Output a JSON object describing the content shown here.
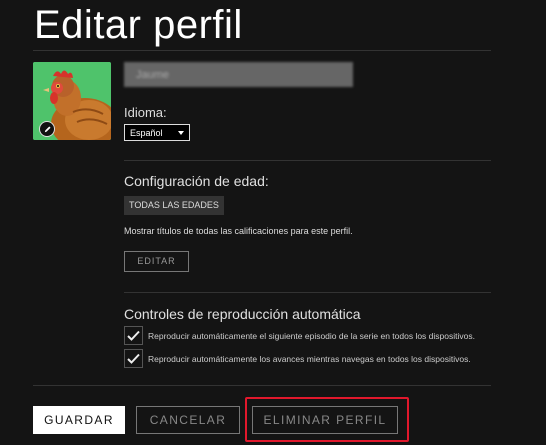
{
  "page": {
    "title": "Editar perfil"
  },
  "profile": {
    "name_value": "Jaume",
    "avatar_icon": "chicken-avatar-image",
    "edit_avatar_icon": "pencil-icon"
  },
  "language": {
    "label": "Idioma:",
    "selected": "Español"
  },
  "age": {
    "section_title": "Configuración de edad:",
    "badge": "TODAS LAS EDADES",
    "description": "Mostrar títulos de todas las calificaciones para este perfil.",
    "edit_button": "EDITAR"
  },
  "autoplay": {
    "section_title": "Controles de reproducción automática",
    "options": [
      {
        "label": "Reproducir automáticamente el siguiente episodio de la serie en todos los dispositivos.",
        "checked": true
      },
      {
        "label": "Reproducir automáticamente los avances mientras navegas en todos los dispositivos.",
        "checked": true
      }
    ]
  },
  "actions": {
    "save": "GUARDAR",
    "cancel": "CANCELAR",
    "delete": "ELIMINAR PERFIL"
  },
  "colors": {
    "background": "#141414",
    "highlight": "#e1182c",
    "avatar_bg": "#4fc36b"
  }
}
